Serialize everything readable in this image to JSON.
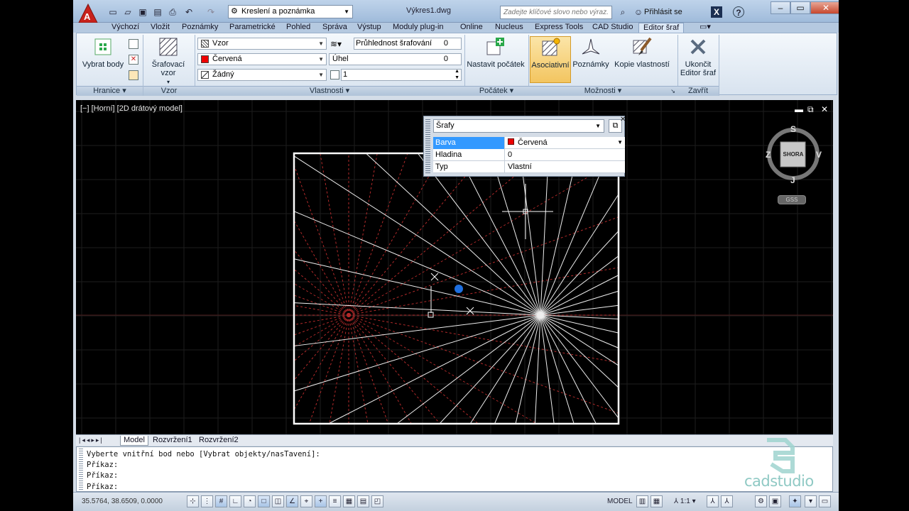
{
  "title_bar": {
    "window_title": "Výkres1.dwg",
    "workspace": "Kreslení a poznámka",
    "search_placeholder": "Zadejte klíčové slovo nebo výraz.",
    "login": "Přihlásit se",
    "help": "?"
  },
  "ribbon_tabs": [
    "Výchozí",
    "Vložit",
    "Poznámky",
    "Parametrické",
    "Pohled",
    "Správa",
    "Výstup",
    "Moduly plug-in",
    "Online",
    "Nucleus",
    "Express Tools",
    "CAD Studio",
    "Editor šraf"
  ],
  "ribbon": {
    "boundary": {
      "pick_points": "Vybrat body",
      "panel": "Hranice"
    },
    "pattern": {
      "hatch_pattern": "Šrafovací vzor",
      "panel": "Vzor"
    },
    "properties": {
      "type": "Vzor",
      "color": "Červená",
      "background": "Žádný",
      "transparency_label": "Průhlednost šrafování",
      "transparency_value": "0",
      "angle_label": "Úhel",
      "angle_value": "0",
      "scale_value": "1",
      "panel": "Vlastnosti"
    },
    "origin": {
      "set_origin": "Nastavit počátek",
      "panel": "Počátek"
    },
    "options": {
      "associative": "Asociativní",
      "annotative": "Poznámky",
      "match_properties": "Kopie vlastností",
      "panel": "Možnosti"
    },
    "close": {
      "close_editor_line1": "Ukončit",
      "close_editor_line2": "Editor šraf",
      "panel": "Zavřít"
    }
  },
  "viewport": {
    "label": "[−] [Horní] [2D drátový model]",
    "nav": {
      "top": "S",
      "bottom": "J",
      "left": "Z",
      "right": "V",
      "face": "SHORA",
      "wcs": "GSS"
    }
  },
  "properties_palette": {
    "object": "Šrafy",
    "rows": [
      {
        "key": "Barva",
        "value": "Červená"
      },
      {
        "key": "Hladina",
        "value": "0"
      },
      {
        "key": "Typ",
        "value": "Vlastní"
      }
    ]
  },
  "layout_tabs": [
    "Model",
    "Rozvržení1",
    "Rozvržení2"
  ],
  "command_line": [
    "Vyberte vnitřní bod nebo [Vybrat objekty/nasTavení]:",
    "Příkaz:",
    "Příkaz:",
    "Příkaz:"
  ],
  "status_bar": {
    "coords": "35.5764, 38.6509, 0.0000",
    "model": "MODEL",
    "scale": "1:1"
  },
  "watermark": "cadstudio",
  "colors": {
    "accent": "#3399ff",
    "hatch_red": "#c0392b",
    "ribbon": "#dce8f6"
  }
}
